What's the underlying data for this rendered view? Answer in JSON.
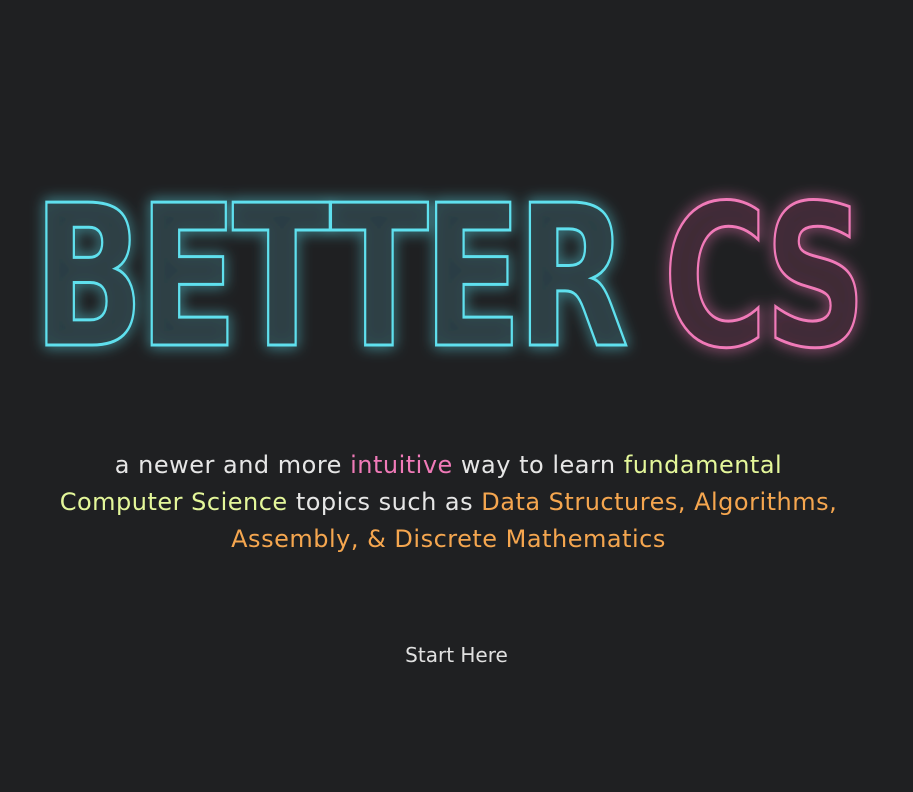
{
  "hero": {
    "word_better": "BETTER",
    "word_cs": "CS",
    "better_color": "#5fe0ee",
    "cs_color": "#f07ab8"
  },
  "tagline": {
    "part1": "a newer and more ",
    "highlight1": "intuitive",
    "part2": " way to learn ",
    "highlight2": "fundamental Computer Science",
    "part3": " topics such as ",
    "highlight3": "Data Structures, Algorithms, Assembly, & Discrete Mathematics"
  },
  "cta": {
    "label": "Start Here"
  }
}
